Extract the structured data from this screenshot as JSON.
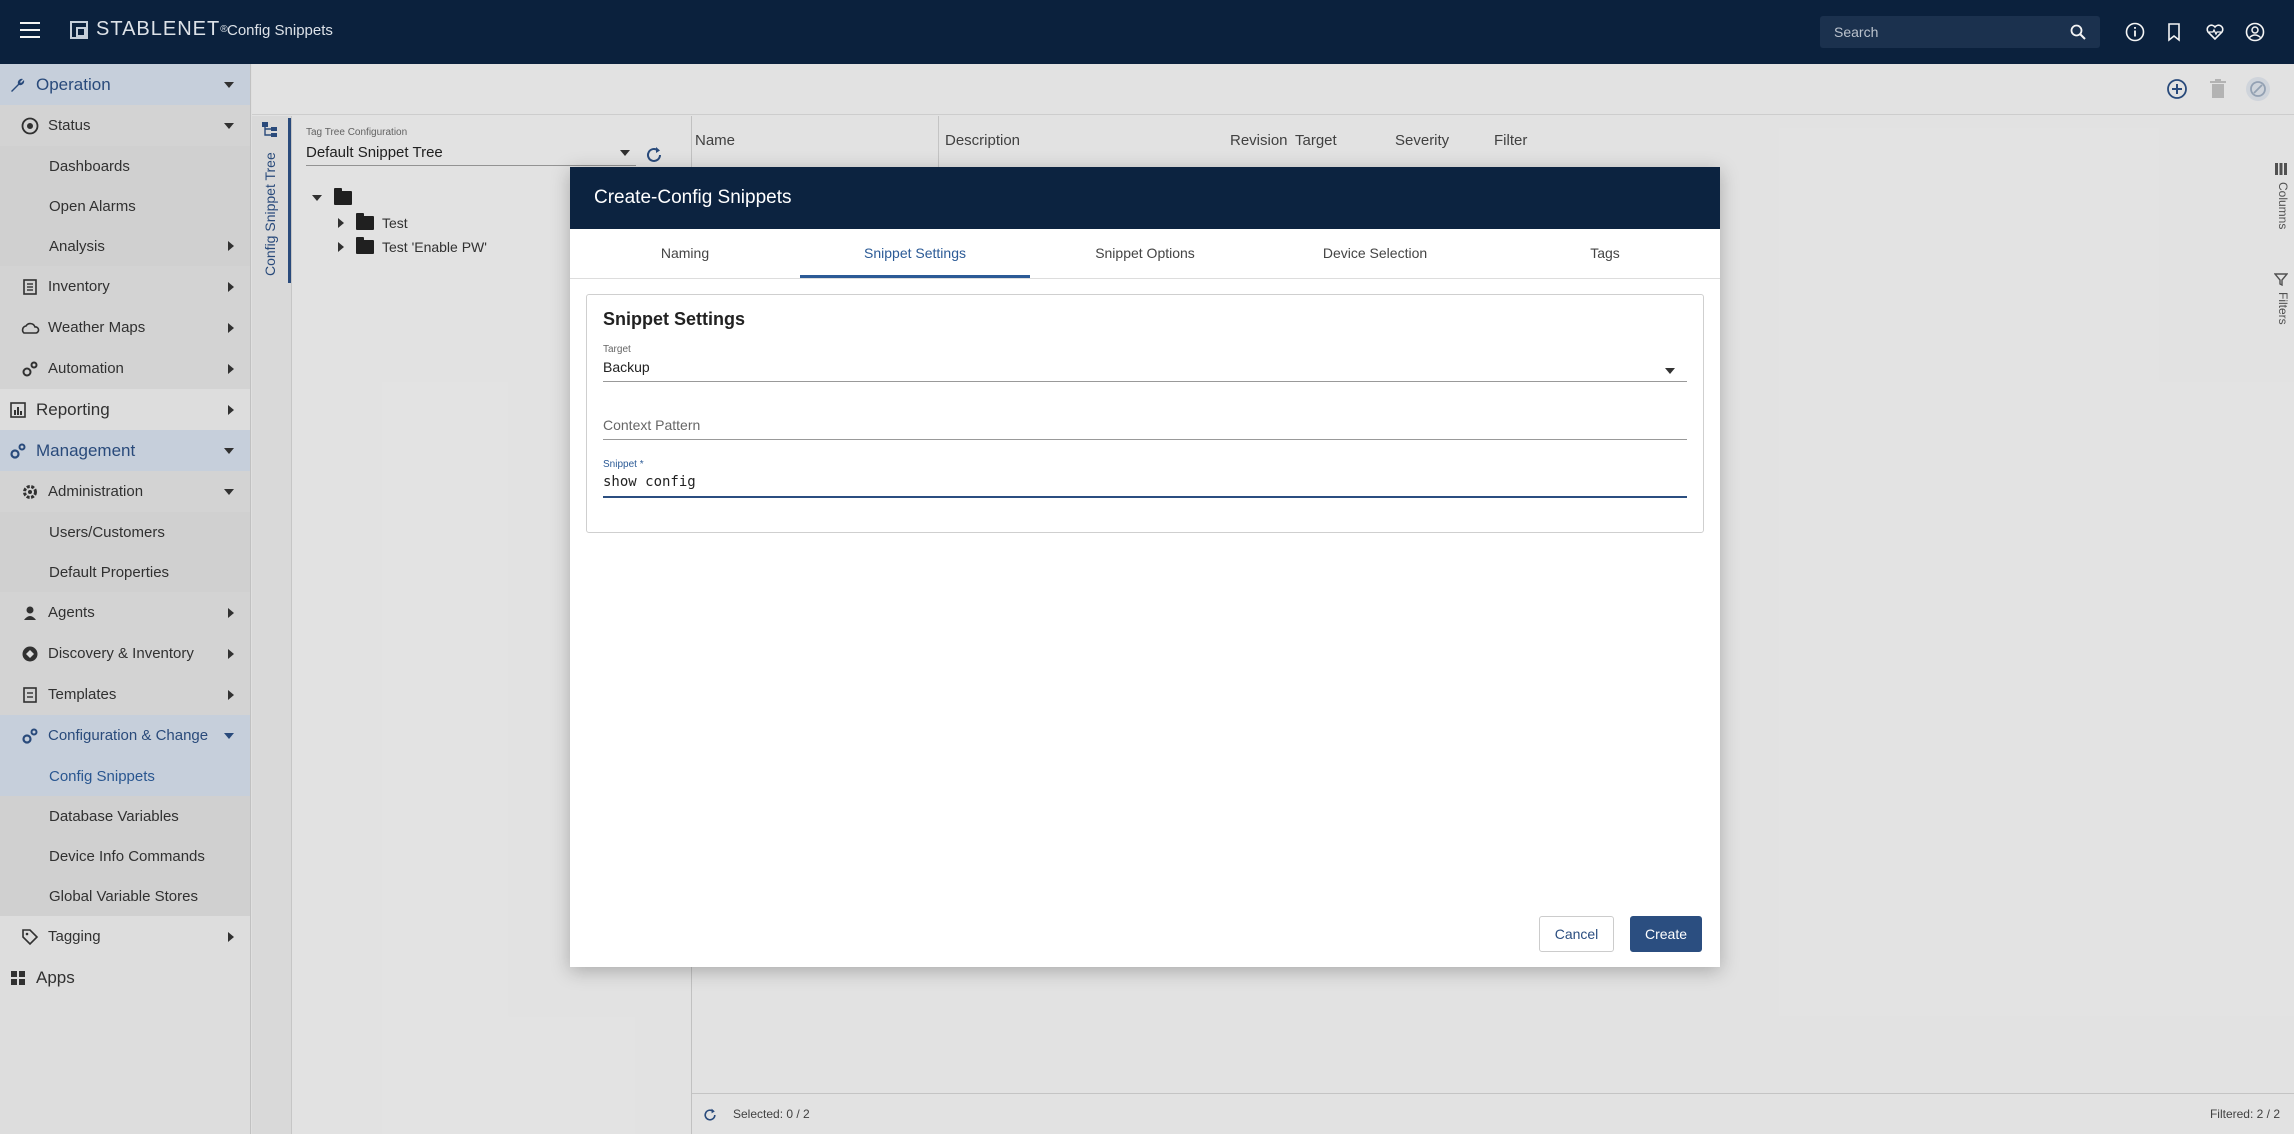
{
  "app": {
    "brand": "STABLENET",
    "brand_sup": "®",
    "title": "Config Snippets",
    "search_placeholder": "Search"
  },
  "sidebar": {
    "items": [
      {
        "label": "Operation",
        "kind": "group",
        "icon": "wrench-icon",
        "expanded": true
      },
      {
        "label": "Status",
        "kind": "level1",
        "icon": "status-icon",
        "expanded": true
      },
      {
        "label": "Dashboards",
        "kind": "sub"
      },
      {
        "label": "Open Alarms",
        "kind": "sub"
      },
      {
        "label": "Analysis",
        "kind": "sub-caret"
      },
      {
        "label": "Inventory",
        "kind": "level1",
        "icon": "inventory-icon"
      },
      {
        "label": "Weather Maps",
        "kind": "level1",
        "icon": "weather-map-icon"
      },
      {
        "label": "Automation",
        "kind": "level1",
        "icon": "automation-icon"
      },
      {
        "label": "Reporting",
        "kind": "group",
        "icon": "reporting-icon"
      },
      {
        "label": "Management",
        "kind": "group",
        "icon": "management-icon",
        "expanded": true
      },
      {
        "label": "Administration",
        "kind": "level1",
        "icon": "gear-icon",
        "expanded": true
      },
      {
        "label": "Users/Customers",
        "kind": "sub"
      },
      {
        "label": "Default Properties",
        "kind": "sub"
      },
      {
        "label": "Agents",
        "kind": "level1",
        "icon": "agents-icon"
      },
      {
        "label": "Discovery & Inventory",
        "kind": "level1",
        "icon": "discovery-icon"
      },
      {
        "label": "Templates",
        "kind": "level1",
        "icon": "templates-icon"
      },
      {
        "label": "Configuration & Change",
        "kind": "level1",
        "icon": "config-change-icon",
        "expanded": true
      },
      {
        "label": "Config Snippets",
        "kind": "sub",
        "active": true
      },
      {
        "label": "Database Variables",
        "kind": "sub"
      },
      {
        "label": "Device Info Commands",
        "kind": "sub"
      },
      {
        "label": "Global Variable Stores",
        "kind": "sub"
      },
      {
        "label": "Tagging",
        "kind": "level0",
        "icon": "tag-icon"
      },
      {
        "label": "Apps",
        "kind": "group",
        "icon": "apps-icon"
      }
    ]
  },
  "tree": {
    "rail_label": "Config Snippet Tree",
    "config_label": "Tag Tree Configuration",
    "config_value": "Default Snippet Tree",
    "nodes": [
      {
        "label": ""
      },
      {
        "label": "Test"
      },
      {
        "label": "Test 'Enable PW'"
      }
    ]
  },
  "grid": {
    "columns": [
      "Name",
      "Description",
      "Revision",
      "Target",
      "Severity",
      "Filter"
    ],
    "selected": "Selected: 0 / 2",
    "filtered": "Filtered: 2 / 2",
    "side_tabs": [
      "Columns",
      "Filters"
    ]
  },
  "modal": {
    "title": "Create-Config Snippets",
    "tabs": [
      "Naming",
      "Snippet Settings",
      "Snippet Options",
      "Device Selection",
      "Tags"
    ],
    "active_tab": 1,
    "section_title": "Snippet Settings",
    "target": {
      "label": "Target",
      "value": "Backup"
    },
    "context_pattern": {
      "placeholder": "Context Pattern"
    },
    "snippet": {
      "label": "Snippet *",
      "value": "show config"
    },
    "cancel_label": "Cancel",
    "create_label": "Create"
  },
  "colors": {
    "topbar": "#0c2340",
    "accent": "#2b4e80"
  }
}
